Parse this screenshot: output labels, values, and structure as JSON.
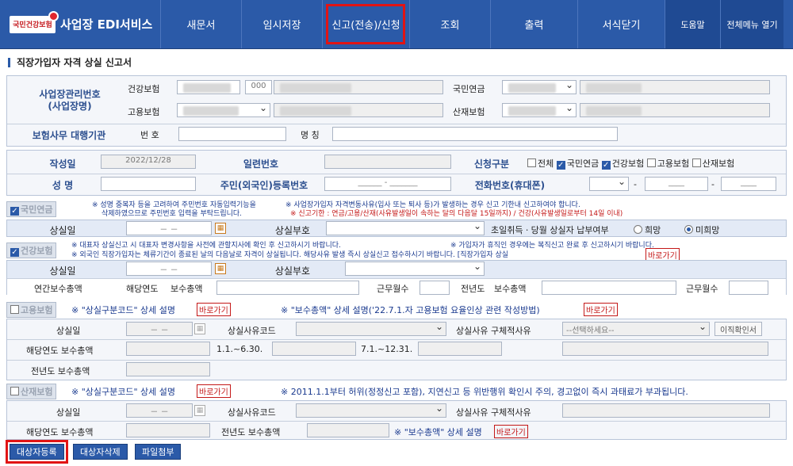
{
  "header": {
    "logo_badge": "국민건강보험",
    "app_title": "사업장 EDI서비스",
    "menu": [
      "새문서",
      "임시저장",
      "신고(전송)/신청",
      "조회",
      "출력",
      "서식닫기"
    ],
    "help": "도움말",
    "all_menu": "전체메뉴 열기"
  },
  "page_title": "직장가입자 자격 상실 신고서",
  "employer": {
    "mgmt_no_label": "사업장관리번호\n(사업장명)",
    "health": "건강보험",
    "pension": "국민연금",
    "employment": "고용보험",
    "accident": "산재보험",
    "code": "000",
    "agency_label": "보험사무 대행기관",
    "number": "번 호",
    "name": "명 칭"
  },
  "form": {
    "written_date_label": "작성일",
    "written_date": "2022/12/28",
    "serial_label": "일련번호",
    "apply_label": "신청구분",
    "apply_options": [
      {
        "label": "전체",
        "checked": false
      },
      {
        "label": "국민연금",
        "checked": true
      },
      {
        "label": "건강보험",
        "checked": true
      },
      {
        "label": "고용보험",
        "checked": false
      },
      {
        "label": "산재보험",
        "checked": false
      }
    ],
    "name_label": "성  명",
    "rrn_label": "주민(외국인)등록번호",
    "rrn_placeholder": "______ - _______",
    "phone_label": "전화번호(휴대폰)",
    "phone_dash": "-",
    "phone_part": "____"
  },
  "pension": {
    "tag": "국민연금",
    "note1": "※ 성명 중복자 등을 고려하여 주민번호 자동입력기능을",
    "note1b": "삭제하였으므로 주민번호 입력을 부탁드립니다.",
    "note2": "※ 사업장가입자 자격변동사유(입사 또는 퇴사 등)가 발생하는 경우 신고 기한내 신고하여야 합니다.",
    "note2b": "※ 신고기한 : 연금/고용/산재(사유발생일이 속하는 달의 다음달 15일까지) / 건강(사유발생일로부터 14일 이내)",
    "loss_date": "상실일",
    "date_blank": "－ －",
    "loss_code": "상실부호",
    "first_pay": "초일취득ㆍ당월 상실자 납부여부",
    "want": "희망",
    "not_want": "미희망"
  },
  "health": {
    "tag": "건강보험",
    "note1": "※ 대표자 상실신고 시 대표자 변경사항을 사전에 관할지사에 확인 후 신고하시기 바랍니다.",
    "note1b": "※ 가입자가 휴직인 경우에는 복직신고 완료 후 신고하시기 바랍니다.",
    "note2": "※ 외국인 직장가입자는 체류기간이 종료된 날의 다음날로 자격이 상실됩니다. 해당사유 발생 즉시 상실신고 접수하시기 바랍니다. [직장가입자 상실",
    "link": "바로가기",
    "loss_date": "상실일",
    "date_blank": "－ －",
    "loss_code": "상실부호",
    "annual_total": "연간보수총액",
    "this_year": "해당연도",
    "pay_total": "보수총액",
    "months": "근무월수",
    "prev_year": "전년도"
  },
  "employment": {
    "tag": "고용보험",
    "note1": "※ \"상실구분코드\" 상세 설명",
    "link1": "바로가기",
    "note2": "※ \"보수총액\" 상세 설명('22.7.1.자 고용보험 요율인상 관련 작성방법)",
    "link2": "바로가기",
    "loss_date": "상실일",
    "date_blank": "－ －",
    "reason_code": "상실사유코드",
    "reason_detail": "상실사유 구체적사유",
    "select_placeholder": "--선택하세요--",
    "history_btn": "이직확인서",
    "this_year_pay": "해당연도 보수총액",
    "period1": "1.1.~6.30.",
    "period2": "7.1.~12.31.",
    "prev_year_pay": "전년도 보수총액"
  },
  "accident": {
    "tag": "산재보험",
    "note1": "※ \"상실구분코드\" 상세 설명",
    "link1": "바로가기",
    "note2": "※ 2011.1.1부터 허위(정정신고 포함), 지연신고 등 위반행위 확인시 주의, 경고없이 즉시 과태료가 부과됩니다.",
    "loss_date": "상실일",
    "date_blank": "－ －",
    "reason_code": "상실사유코드",
    "reason_detail": "상실사유 구체적사유",
    "this_year_pay": "해당연도 보수총액",
    "prev_year_pay": "전년도 보수총액",
    "note3": "※ \"보수총액\" 상세 설명",
    "link3": "바로가기"
  },
  "buttons": {
    "register": "대상자등록",
    "delete": "대상자삭제",
    "attach": "파일첨부"
  }
}
